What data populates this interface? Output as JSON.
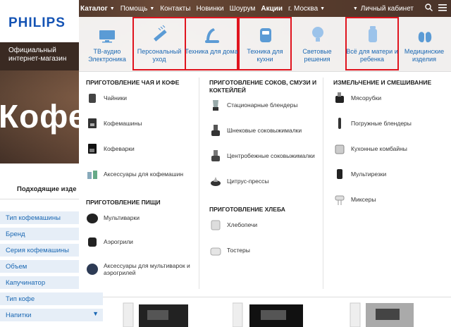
{
  "nav": {
    "catalog": "Каталог",
    "help": "Помощь",
    "contacts": "Контакты",
    "news": "Новинки",
    "showroom": "Шоурум",
    "deals": "Акции",
    "city": "г. Москва",
    "account": "Личный кабинет"
  },
  "logo": {
    "brand": "PHILIPS",
    "subtitle": "Официальный интернет-магазин"
  },
  "hero": {
    "title": "Кофе"
  },
  "categories": [
    {
      "label": "ТВ-аудио Электроника",
      "icon": "tv-icon"
    },
    {
      "label": "Персональный уход",
      "icon": "comb-icon"
    },
    {
      "label": "Техника для дома",
      "icon": "vacuum-icon"
    },
    {
      "label": "Техника для кухни",
      "icon": "airfryer-icon"
    },
    {
      "label": "Световые решения",
      "icon": "lightbulb-icon"
    },
    {
      "label": "Всё для матери и ребенка",
      "icon": "baby-bottle-icon"
    },
    {
      "label": "Медицинские изделия",
      "icon": "lungs-icon"
    }
  ],
  "menu": {
    "col1": {
      "heading1": "ПРИГОТОВЛЕНИЕ ЧАЯ И КОФЕ",
      "items1": [
        "Чайники",
        "Кофемашины",
        "Кофеварки",
        "Аксессуары для кофемашин"
      ],
      "heading2": "ПРИГОТОВЛЕНИЕ ПИЩИ",
      "items2": [
        "Мультиварки",
        "Аэрогрили",
        "Аксессуары для мультиварок и аэрогрилей"
      ]
    },
    "col2": {
      "heading1": "ПРИГОТОВЛЕНИЕ СОКОВ, СМУЗИ И КОКТЕЙЛЕЙ",
      "items1": [
        "Стационарные блендеры",
        "Шнековые соковыжималки",
        "Центробежные соковыжималки",
        "Цитрус-прессы"
      ],
      "heading2": "ПРИГОТОВЛЕНИЕ ХЛЕБА",
      "items2": [
        "Хлебопечи",
        "Тостеры"
      ]
    },
    "col3": {
      "heading1": "ИЗМЕЛЬЧЕНИЕ И СМЕШИВАНИЕ",
      "items1": [
        "Мясорубки",
        "Погружные блендеры",
        "Кухонные комбайны",
        "Мультирезки",
        "Миксеры"
      ]
    }
  },
  "filters": {
    "heading": "Подходящие изде",
    "items": [
      "Тип кофемашины",
      "Бренд",
      "Серия кофемашины",
      "Объем",
      "Капучинатор",
      "Тип кофе",
      "Напитки"
    ]
  },
  "colors": {
    "accent": "#1b68b3",
    "highlight": "#e0141e",
    "brand": "#1453b4"
  }
}
